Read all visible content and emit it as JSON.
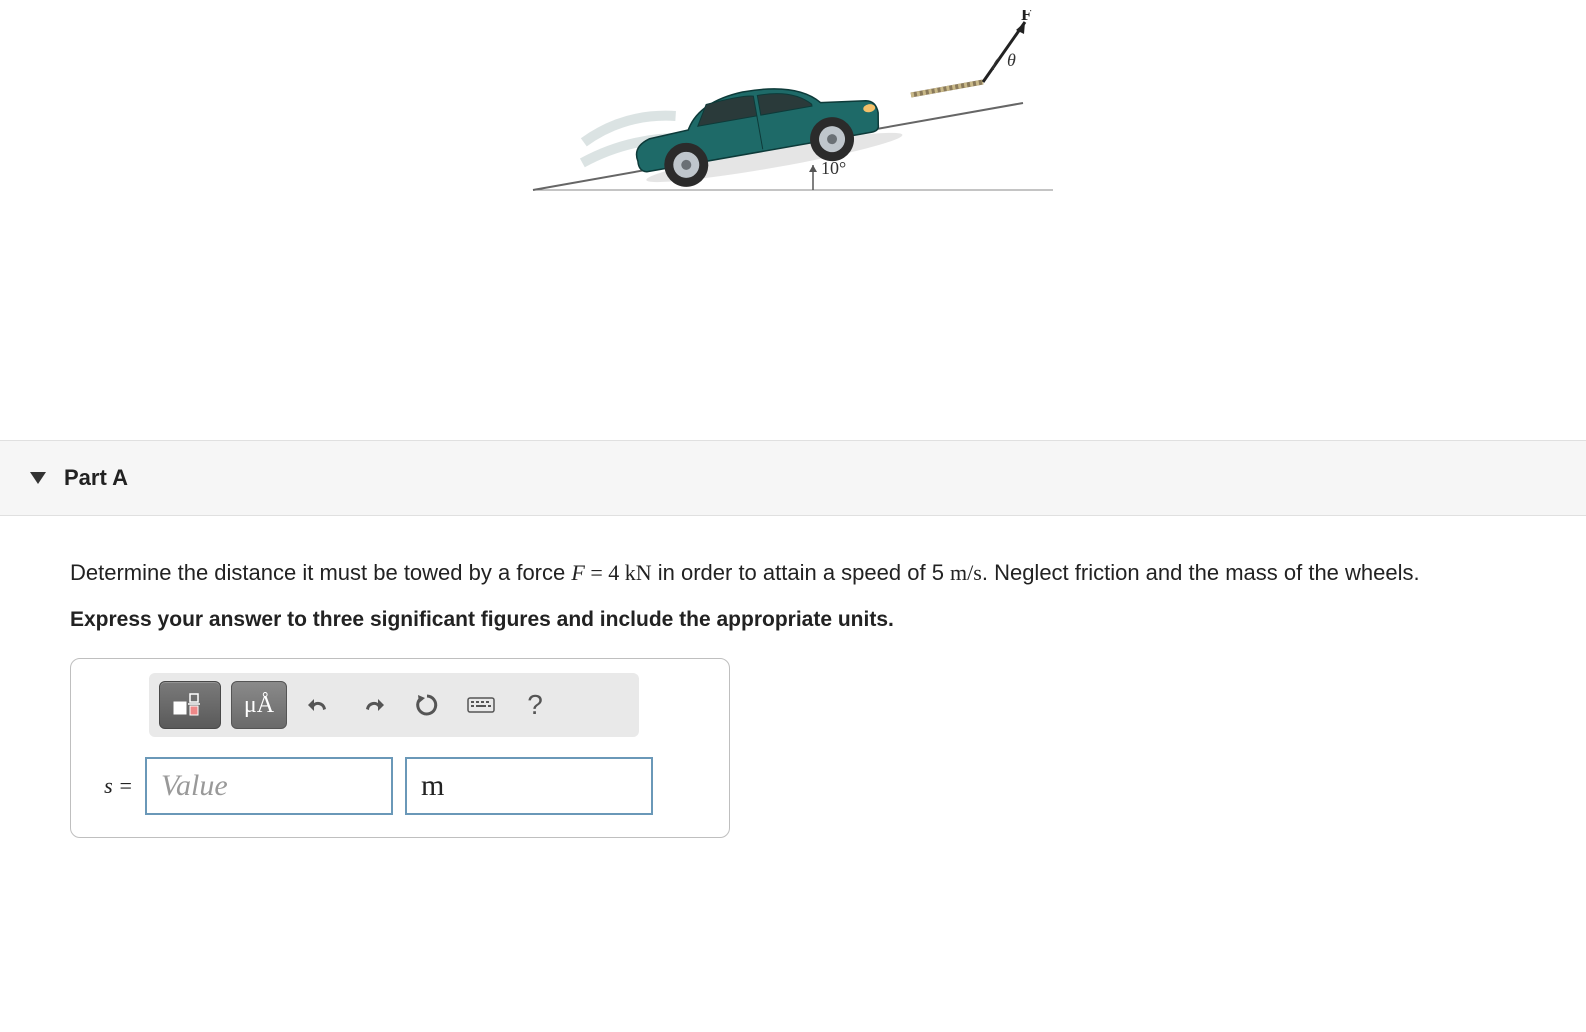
{
  "figure": {
    "force_label": "F",
    "angle_label_theta": "θ",
    "incline_angle": "10°"
  },
  "part": {
    "title": "Part A"
  },
  "question": {
    "prefix": "Determine the distance it must be towed by a force ",
    "force_var": "F",
    "force_eq": " = 4 ",
    "force_unit": "kN",
    "mid": " in order to attain a speed of 5 ",
    "speed_unit": "m/s",
    "suffix": ". Neglect friction and the mass of the wheels."
  },
  "instruction": "Express your answer to three significant figures and include the appropriate units.",
  "toolbar": {
    "special_chars": "μÅ",
    "help": "?"
  },
  "answer": {
    "variable": "s =",
    "value_placeholder": "Value",
    "unit": "m"
  }
}
